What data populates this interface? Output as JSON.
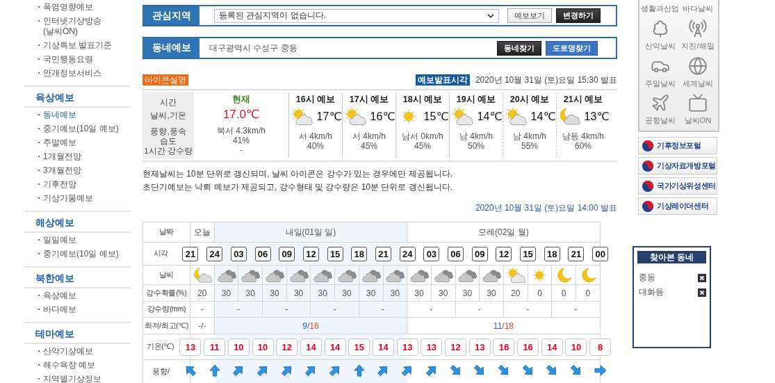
{
  "sidebar": {
    "sections": [
      {
        "items": [
          {
            "label": "폭염영향예보",
            "selected": false
          },
          {
            "label": "인터넷기상방송\n(날씨ON)",
            "selected": false
          },
          {
            "label": "기상특보 발표기준",
            "selected": false
          },
          {
            "label": "국민행동요령",
            "selected": false
          },
          {
            "label": "안개정보서비스",
            "selected": false
          }
        ]
      },
      {
        "title": "육상예보",
        "items": [
          {
            "label": "동네예보",
            "selected": true
          },
          {
            "label": "중기예보(10일 예보)",
            "selected": false
          },
          {
            "label": "주말예보",
            "selected": false
          },
          {
            "label": "1개월전망",
            "selected": false
          },
          {
            "label": "3개월전망",
            "selected": false
          },
          {
            "label": "기후전망",
            "selected": false
          },
          {
            "label": "기상가뭄예보",
            "selected": false
          }
        ]
      },
      {
        "title": "해상예보",
        "items": [
          {
            "label": "일일예보",
            "selected": false
          },
          {
            "label": "중기예보(10일 예보)",
            "selected": false
          }
        ]
      },
      {
        "title": "북한예보",
        "items": [
          {
            "label": "육상예보",
            "selected": false
          },
          {
            "label": "바다예보",
            "selected": false
          }
        ]
      },
      {
        "title": "테마예보",
        "items": [
          {
            "label": "산악기상예보",
            "selected": false
          },
          {
            "label": "해수욕장 예보",
            "selected": false
          },
          {
            "label": "지역별기상정보",
            "selected": false
          }
        ]
      }
    ]
  },
  "interest": {
    "label": "관심지역",
    "select_value": "등록된 관심지역이 없습니다.",
    "buttons": [
      {
        "label": "예보보기",
        "kind": "light"
      },
      {
        "label": "변경하기",
        "kind": "dark"
      }
    ]
  },
  "local": {
    "label": "동네예보",
    "address": "대구광역시 수성구 중동",
    "buttons": [
      {
        "label": "동네찾기",
        "kind": "dark"
      },
      {
        "label": "도로명찾기",
        "kind": "blue"
      }
    ]
  },
  "icon_legend": "아이콘설명",
  "issued_badge": "예보발표시각",
  "issued_time": "2020년 10월 31일 (토)요일 15:30 발표",
  "current": {
    "labels": [
      "시간",
      "날씨,기온",
      "풍향,풍속",
      "습도",
      "1시간 강수량"
    ],
    "now": {
      "title": "현재",
      "temp": "17.0℃",
      "wind": "북서 4.3km/h",
      "humidity": "41%",
      "rain": "-"
    },
    "forecasts": [
      {
        "title": "16시 예보",
        "kind": "sun-cloud",
        "temp": "17℃",
        "wind": "서 4km/h",
        "humidity": "40%",
        "dashed": false
      },
      {
        "title": "17시 예보",
        "kind": "sun-cloud",
        "temp": "16℃",
        "wind": "서 4km/h",
        "humidity": "45%",
        "dashed": false
      },
      {
        "title": "18시 예보",
        "kind": "sun",
        "temp": "15℃",
        "wind": "남서 0km/h",
        "humidity": "45%",
        "dashed": false
      },
      {
        "title": "19시 예보",
        "kind": "sun-cloud",
        "temp": "14℃",
        "wind": "남 4km/h",
        "humidity": "50%",
        "dashed": false
      },
      {
        "title": "20시 예보",
        "kind": "sun-cloud",
        "temp": "14℃",
        "wind": "남 4km/h",
        "humidity": "55%",
        "dashed": true
      },
      {
        "title": "21시 예보",
        "kind": "moon-cloud",
        "temp": "13℃",
        "wind": "남동 4km/h",
        "humidity": "60%",
        "dashed": true
      }
    ]
  },
  "notes": [
    "현재날씨는 10분 단위로 갱신되며, 날씨 아이콘은 강수가 있는 경우에만 제공됩니다.",
    "초단기예보는 낙뢰 예보가 제공되고, 강수형태 및 강수량은 10분 단위로 갱신됩니다."
  ],
  "table_issued": "2020년 10월 31일 (토)요일 14:00 발표",
  "table": {
    "row_labels": [
      "날짜",
      "시각",
      "날씨",
      "강수확률(%)",
      "강수량(mm)",
      "최저/최고(℃)",
      "기온(℃)",
      "풍향/"
    ],
    "minmax_separator": "/",
    "days": [
      {
        "label": "오늘",
        "shaded": false,
        "min": "-",
        "max": "-",
        "rain": [
          "-"
        ],
        "slots": [
          {
            "kind": "moon-cloud",
            "pop": "20"
          }
        ]
      },
      {
        "label": "내일(01일 일)",
        "shaded": true,
        "min": "9",
        "max": "16",
        "rain": [
          "-",
          "-",
          "-",
          "-"
        ],
        "slots": [
          {
            "kind": "cloud",
            "pop": "30"
          },
          {
            "kind": "cloud",
            "pop": "30"
          },
          {
            "kind": "cloud",
            "pop": "30"
          },
          {
            "kind": "cloud",
            "pop": "30"
          },
          {
            "kind": "cloud",
            "pop": "30"
          },
          {
            "kind": "cloud",
            "pop": "30"
          },
          {
            "kind": "cloud",
            "pop": "30"
          },
          {
            "kind": "cloud",
            "pop": "30"
          }
        ]
      },
      {
        "label": "모레(02일 월)",
        "shaded": false,
        "min": "11",
        "max": "18",
        "rain": [
          "-",
          "-",
          "-",
          "-"
        ],
        "slots": [
          {
            "kind": "cloud",
            "pop": "30"
          },
          {
            "kind": "cloud",
            "pop": "30"
          },
          {
            "kind": "cloud",
            "pop": "30"
          },
          {
            "kind": "cloud",
            "pop": "30"
          },
          {
            "kind": "sun-cloud",
            "pop": "20"
          },
          {
            "kind": "sun",
            "pop": "0"
          },
          {
            "kind": "moon",
            "pop": "0"
          },
          {
            "kind": "moon",
            "pop": "0"
          }
        ]
      }
    ],
    "boundaries": [
      {
        "time": "21",
        "temp": "13",
        "kind": "nw"
      },
      {
        "time": "24",
        "temp": "11",
        "kind": "n"
      },
      {
        "time": "03",
        "temp": "10",
        "kind": "ne"
      },
      {
        "time": "06",
        "temp": "10",
        "kind": "ne"
      },
      {
        "time": "09",
        "temp": "12",
        "kind": "ne"
      },
      {
        "time": "12",
        "temp": "14",
        "kind": "ne"
      },
      {
        "time": "15",
        "temp": "14",
        "kind": "ne"
      },
      {
        "time": "18",
        "temp": "15",
        "kind": "n"
      },
      {
        "time": "21",
        "temp": "14",
        "kind": "ne"
      },
      {
        "time": "24",
        "temp": "13",
        "kind": "ne"
      },
      {
        "time": "03",
        "temp": "13",
        "kind": "ne"
      },
      {
        "time": "06",
        "temp": "12",
        "kind": "se"
      },
      {
        "time": "09",
        "temp": "13",
        "kind": "se"
      },
      {
        "time": "12",
        "temp": "16",
        "kind": "se"
      },
      {
        "time": "15",
        "temp": "16",
        "kind": "se"
      },
      {
        "time": "18",
        "temp": "14",
        "kind": "se"
      },
      {
        "time": "21",
        "temp": "10",
        "kind": "se"
      },
      {
        "time": "00",
        "temp": "8",
        "kind": "e"
      }
    ]
  },
  "quick_links": [
    {
      "label": "생활과산업"
    },
    {
      "label": "바다날씨"
    },
    {
      "label": "산악날씨",
      "kind": "tree"
    },
    {
      "label": "지진/해일",
      "kind": "antenna"
    },
    {
      "label": "주말날씨",
      "kind": "car"
    },
    {
      "label": "세계날씨",
      "kind": "globe"
    },
    {
      "label": "공항날씨",
      "kind": "plane"
    },
    {
      "label": "날씨ON",
      "kind": "tv"
    }
  ],
  "portal_links": [
    "기후정보포털",
    "기상자료개방포털",
    "국가기상위성센터",
    "기상레이더센터"
  ],
  "visited": {
    "title": "찾아본 동네",
    "items": [
      "중동",
      "대화동"
    ]
  }
}
